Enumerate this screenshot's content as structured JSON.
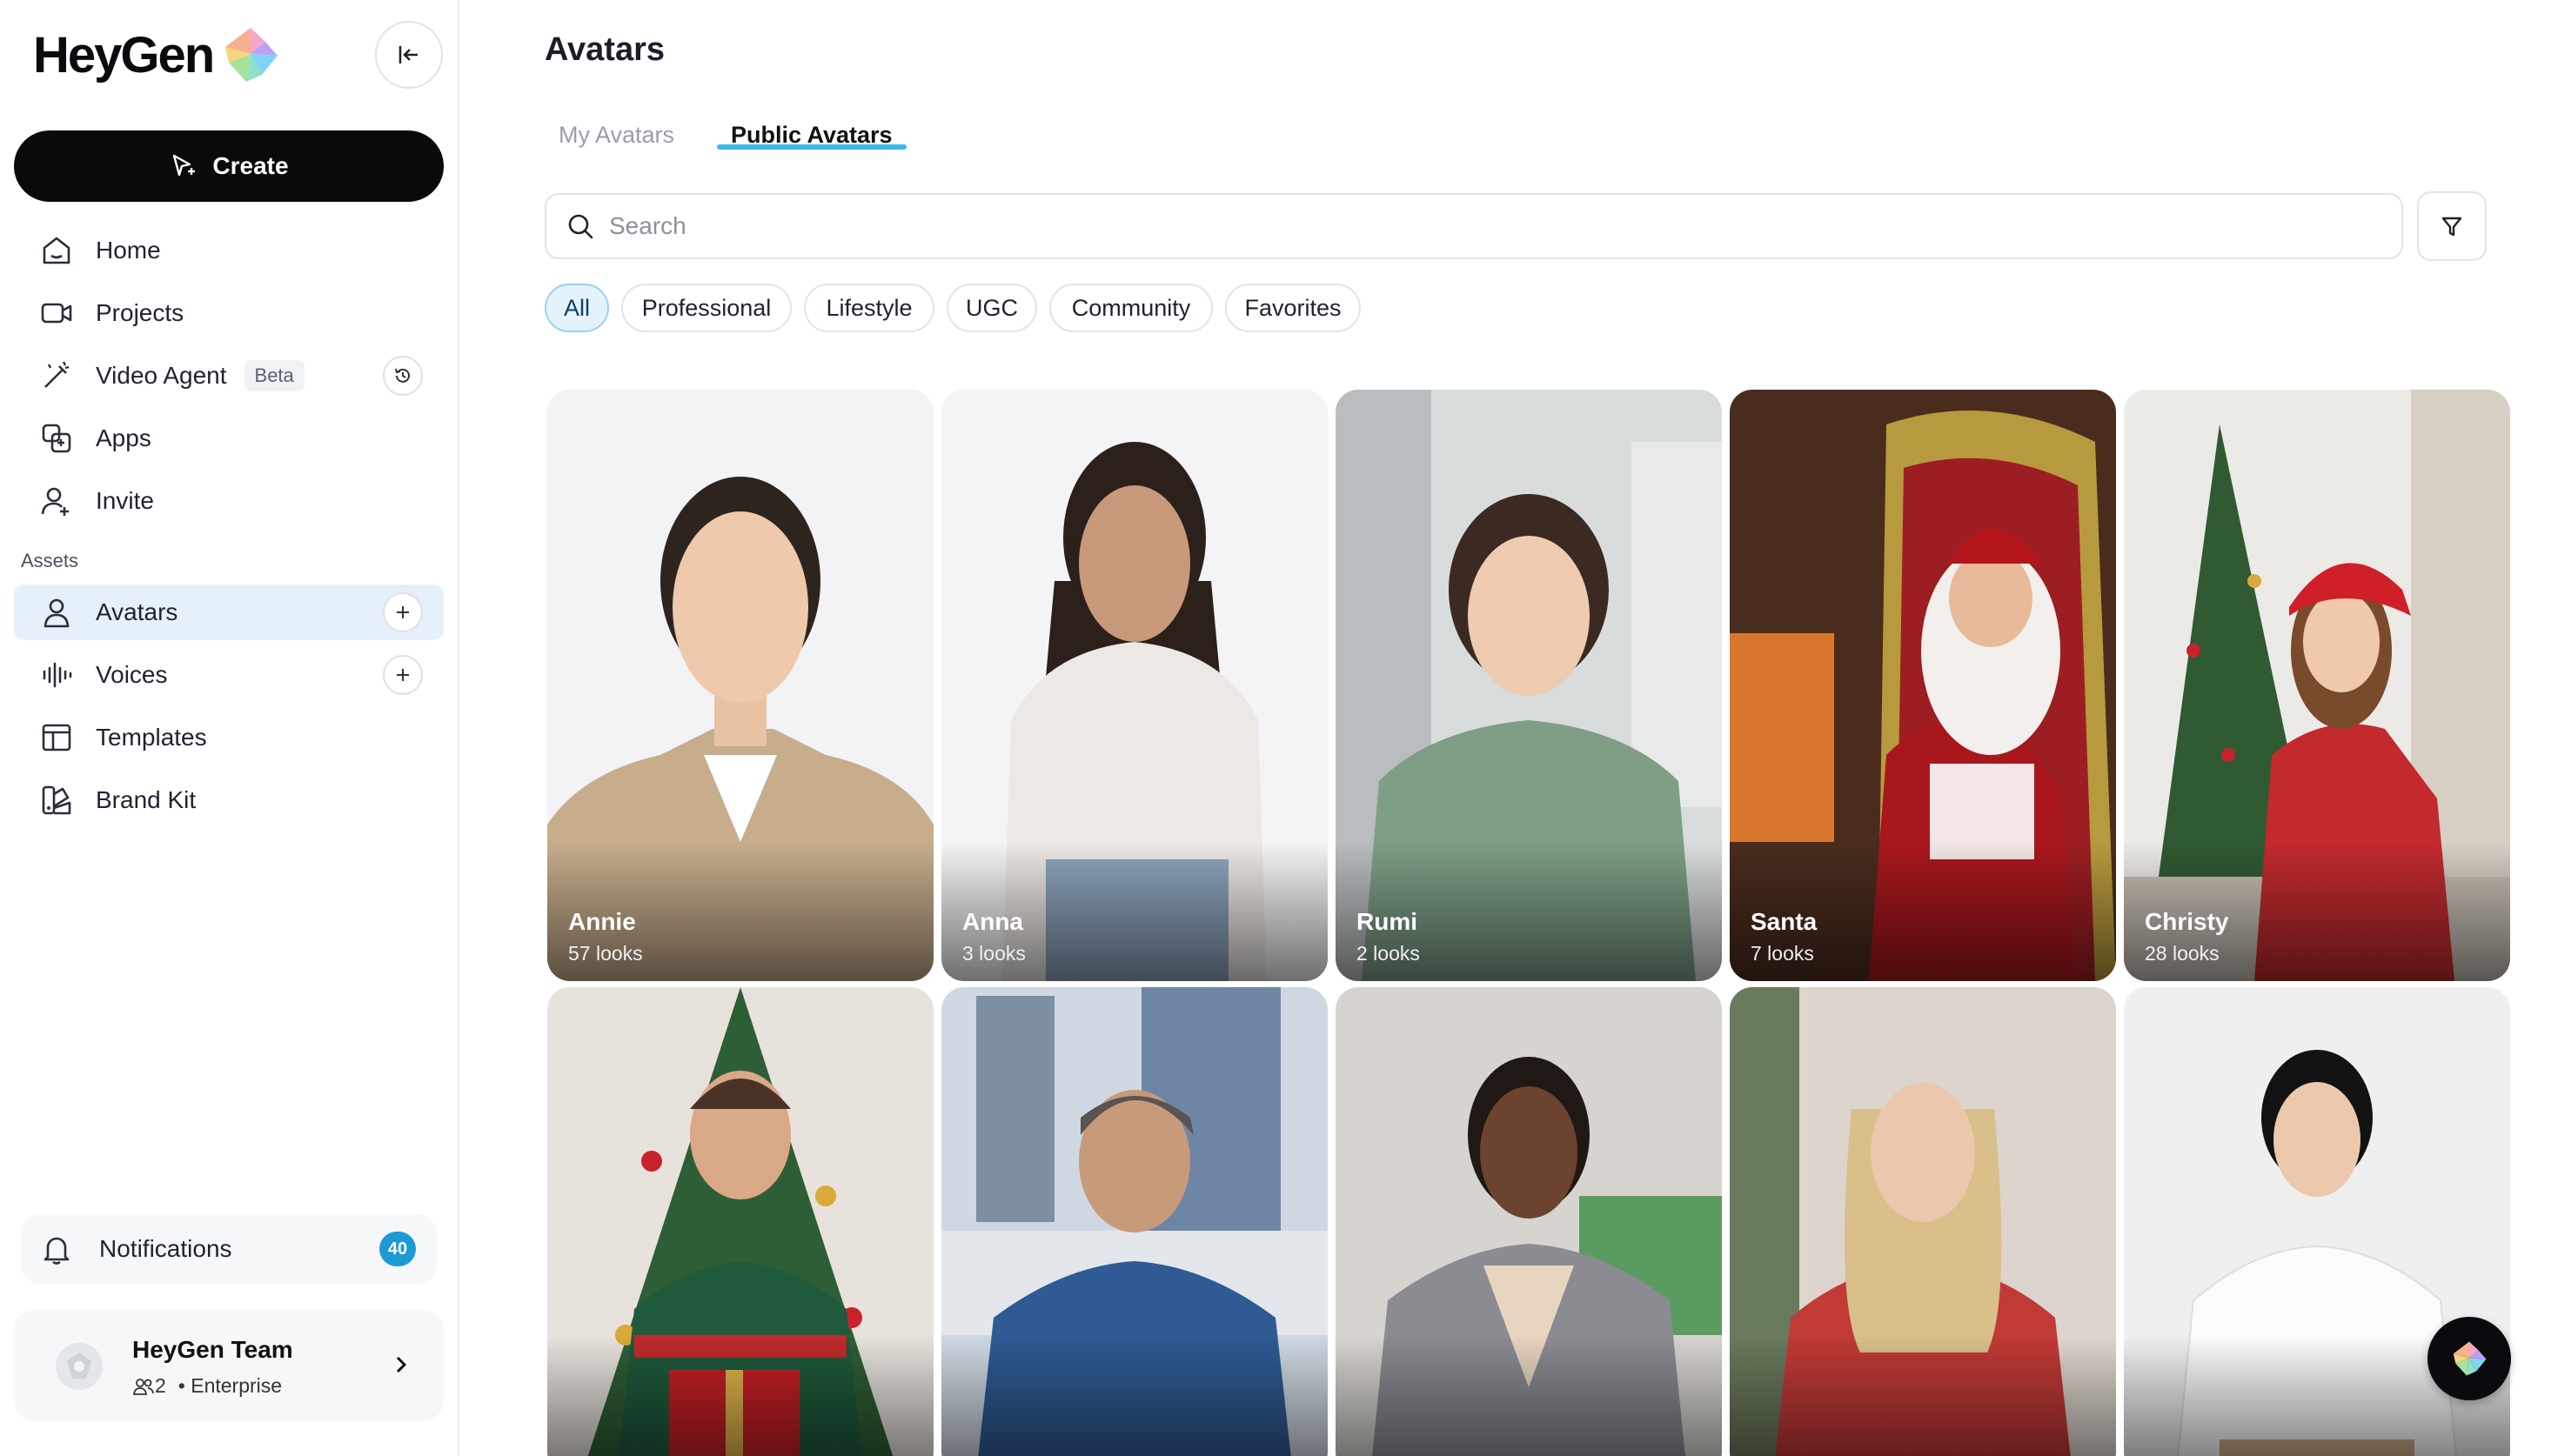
{
  "app": {
    "brand": "HeyGen"
  },
  "sidebar": {
    "create_label": "Create",
    "nav": [
      {
        "label": "Home",
        "icon": "home-icon"
      },
      {
        "label": "Projects",
        "icon": "video-camera-icon"
      },
      {
        "label": "Video Agent",
        "icon": "magic-wand-icon",
        "badge": "Beta"
      },
      {
        "label": "Apps",
        "icon": "apps-icon"
      },
      {
        "label": "Invite",
        "icon": "user-plus-icon"
      }
    ],
    "assets_label": "Assets",
    "assets": [
      {
        "label": "Avatars",
        "icon": "person-icon",
        "active": true
      },
      {
        "label": "Voices",
        "icon": "waveform-icon"
      },
      {
        "label": "Templates",
        "icon": "template-icon"
      },
      {
        "label": "Brand Kit",
        "icon": "brand-kit-icon"
      }
    ],
    "notifications": {
      "label": "Notifications",
      "count": "40"
    },
    "team": {
      "name": "HeyGen Team",
      "members": "2",
      "plan": "• Enterprise"
    }
  },
  "main": {
    "title": "Avatars",
    "tabs": [
      {
        "label": "My Avatars",
        "active": false
      },
      {
        "label": "Public Avatars",
        "active": true
      }
    ],
    "search": {
      "placeholder": "Search",
      "value": ""
    },
    "filters": [
      {
        "label": "All",
        "active": true
      },
      {
        "label": "Professional",
        "active": false
      },
      {
        "label": "Lifestyle",
        "active": false
      },
      {
        "label": "UGC",
        "active": false
      },
      {
        "label": "Community",
        "active": false
      },
      {
        "label": "Favorites",
        "active": false
      }
    ],
    "avatars": [
      {
        "name": "Annie",
        "looks": "57 looks"
      },
      {
        "name": "Anna",
        "looks": "3 looks"
      },
      {
        "name": "Rumi",
        "looks": "2 looks"
      },
      {
        "name": "Santa",
        "looks": "7 looks"
      },
      {
        "name": "Christy",
        "looks": "28 looks"
      },
      {
        "name": "",
        "looks": ""
      },
      {
        "name": "",
        "looks": ""
      },
      {
        "name": "",
        "looks": ""
      },
      {
        "name": "",
        "looks": ""
      },
      {
        "name": "",
        "looks": ""
      }
    ]
  },
  "colors": {
    "accent": "#3fb6e8",
    "badge": "#1d9ad6",
    "active_nav": "#e6f0fb",
    "primary_button": "#0a0a0a"
  }
}
